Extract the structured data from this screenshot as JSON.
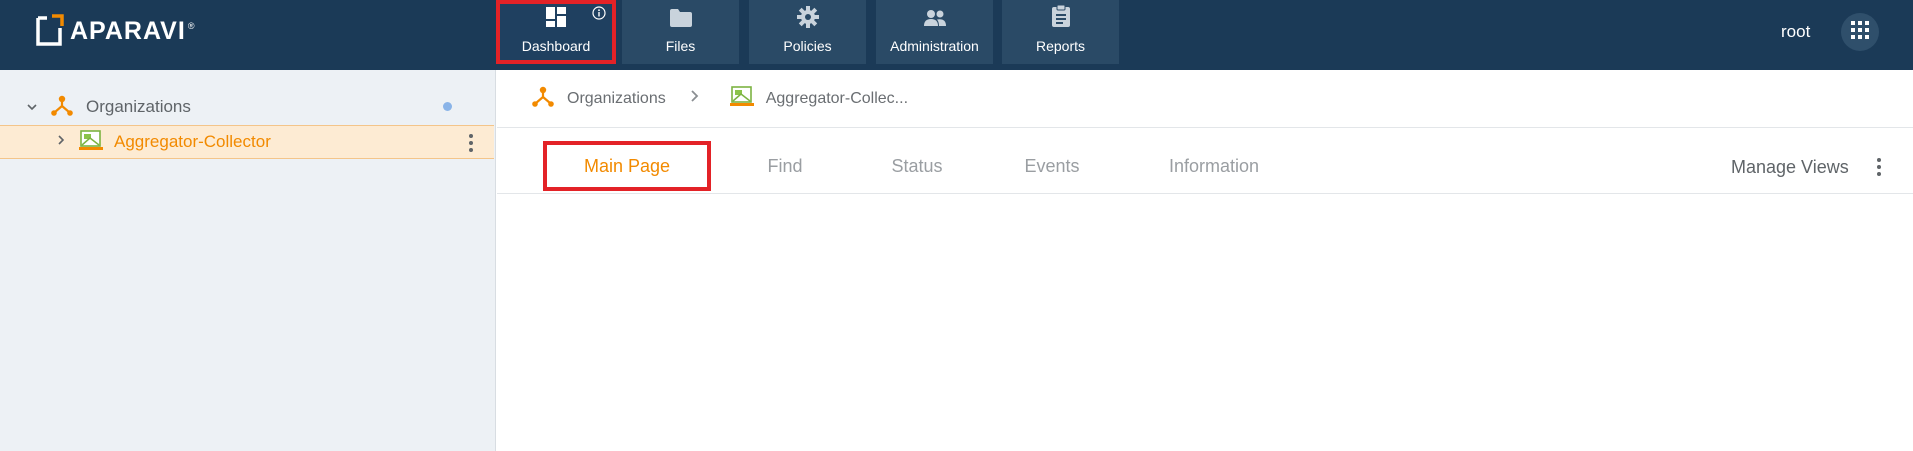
{
  "header": {
    "brand": "APARAVI",
    "brand_mark": "®",
    "user": "root",
    "nav": [
      {
        "label": "Dashboard",
        "icon": "dashboard-icon",
        "active": true
      },
      {
        "label": "Files",
        "icon": "folder-icon"
      },
      {
        "label": "Policies",
        "icon": "gear-icon"
      },
      {
        "label": "Administration",
        "icon": "users-icon"
      },
      {
        "label": "Reports",
        "icon": "clipboard-icon"
      }
    ],
    "apps_icon": "grid-icon"
  },
  "sidebar": {
    "root": {
      "label": "Organizations",
      "icon": "org-tree-icon"
    },
    "selected": {
      "label": "Aggregator-Collector",
      "icon": "collector-icon"
    }
  },
  "breadcrumb": {
    "items": [
      "Organizations",
      "Aggregator-Collec..."
    ]
  },
  "tabs": {
    "items": [
      "Main Page",
      "Find",
      "Status",
      "Events",
      "Information"
    ],
    "active": "Main Page",
    "manage_views": "Manage Views"
  },
  "colors": {
    "topbar": "#1b3a57",
    "accent": "#f28a00",
    "highlight": "#e32227"
  }
}
